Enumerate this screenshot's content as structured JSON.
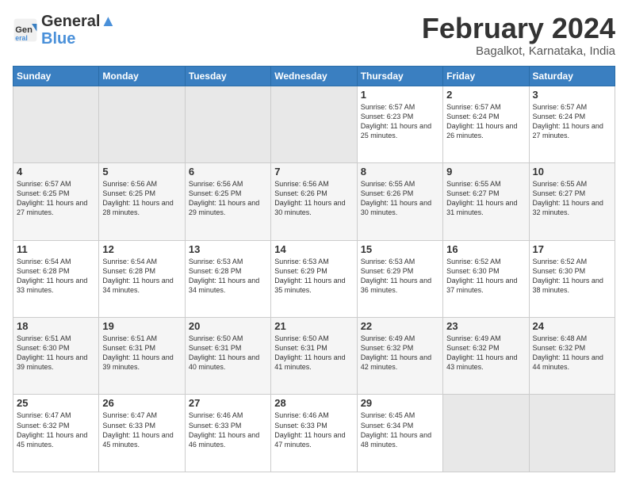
{
  "logo": {
    "line1": "General",
    "line2": "Blue"
  },
  "title": "February 2024",
  "subtitle": "Bagalkot, Karnataka, India",
  "headers": [
    "Sunday",
    "Monday",
    "Tuesday",
    "Wednesday",
    "Thursday",
    "Friday",
    "Saturday"
  ],
  "weeks": [
    [
      {
        "day": "",
        "info": ""
      },
      {
        "day": "",
        "info": ""
      },
      {
        "day": "",
        "info": ""
      },
      {
        "day": "",
        "info": ""
      },
      {
        "day": "1",
        "info": "Sunrise: 6:57 AM\nSunset: 6:23 PM\nDaylight: 11 hours\nand 25 minutes."
      },
      {
        "day": "2",
        "info": "Sunrise: 6:57 AM\nSunset: 6:24 PM\nDaylight: 11 hours\nand 26 minutes."
      },
      {
        "day": "3",
        "info": "Sunrise: 6:57 AM\nSunset: 6:24 PM\nDaylight: 11 hours\nand 27 minutes."
      }
    ],
    [
      {
        "day": "4",
        "info": "Sunrise: 6:57 AM\nSunset: 6:25 PM\nDaylight: 11 hours\nand 27 minutes."
      },
      {
        "day": "5",
        "info": "Sunrise: 6:56 AM\nSunset: 6:25 PM\nDaylight: 11 hours\nand 28 minutes."
      },
      {
        "day": "6",
        "info": "Sunrise: 6:56 AM\nSunset: 6:25 PM\nDaylight: 11 hours\nand 29 minutes."
      },
      {
        "day": "7",
        "info": "Sunrise: 6:56 AM\nSunset: 6:26 PM\nDaylight: 11 hours\nand 30 minutes."
      },
      {
        "day": "8",
        "info": "Sunrise: 6:55 AM\nSunset: 6:26 PM\nDaylight: 11 hours\nand 30 minutes."
      },
      {
        "day": "9",
        "info": "Sunrise: 6:55 AM\nSunset: 6:27 PM\nDaylight: 11 hours\nand 31 minutes."
      },
      {
        "day": "10",
        "info": "Sunrise: 6:55 AM\nSunset: 6:27 PM\nDaylight: 11 hours\nand 32 minutes."
      }
    ],
    [
      {
        "day": "11",
        "info": "Sunrise: 6:54 AM\nSunset: 6:28 PM\nDaylight: 11 hours\nand 33 minutes."
      },
      {
        "day": "12",
        "info": "Sunrise: 6:54 AM\nSunset: 6:28 PM\nDaylight: 11 hours\nand 34 minutes."
      },
      {
        "day": "13",
        "info": "Sunrise: 6:53 AM\nSunset: 6:28 PM\nDaylight: 11 hours\nand 34 minutes."
      },
      {
        "day": "14",
        "info": "Sunrise: 6:53 AM\nSunset: 6:29 PM\nDaylight: 11 hours\nand 35 minutes."
      },
      {
        "day": "15",
        "info": "Sunrise: 6:53 AM\nSunset: 6:29 PM\nDaylight: 11 hours\nand 36 minutes."
      },
      {
        "day": "16",
        "info": "Sunrise: 6:52 AM\nSunset: 6:30 PM\nDaylight: 11 hours\nand 37 minutes."
      },
      {
        "day": "17",
        "info": "Sunrise: 6:52 AM\nSunset: 6:30 PM\nDaylight: 11 hours\nand 38 minutes."
      }
    ],
    [
      {
        "day": "18",
        "info": "Sunrise: 6:51 AM\nSunset: 6:30 PM\nDaylight: 11 hours\nand 39 minutes."
      },
      {
        "day": "19",
        "info": "Sunrise: 6:51 AM\nSunset: 6:31 PM\nDaylight: 11 hours\nand 39 minutes."
      },
      {
        "day": "20",
        "info": "Sunrise: 6:50 AM\nSunset: 6:31 PM\nDaylight: 11 hours\nand 40 minutes."
      },
      {
        "day": "21",
        "info": "Sunrise: 6:50 AM\nSunset: 6:31 PM\nDaylight: 11 hours\nand 41 minutes."
      },
      {
        "day": "22",
        "info": "Sunrise: 6:49 AM\nSunset: 6:32 PM\nDaylight: 11 hours\nand 42 minutes."
      },
      {
        "day": "23",
        "info": "Sunrise: 6:49 AM\nSunset: 6:32 PM\nDaylight: 11 hours\nand 43 minutes."
      },
      {
        "day": "24",
        "info": "Sunrise: 6:48 AM\nSunset: 6:32 PM\nDaylight: 11 hours\nand 44 minutes."
      }
    ],
    [
      {
        "day": "25",
        "info": "Sunrise: 6:47 AM\nSunset: 6:32 PM\nDaylight: 11 hours\nand 45 minutes."
      },
      {
        "day": "26",
        "info": "Sunrise: 6:47 AM\nSunset: 6:33 PM\nDaylight: 11 hours\nand 45 minutes."
      },
      {
        "day": "27",
        "info": "Sunrise: 6:46 AM\nSunset: 6:33 PM\nDaylight: 11 hours\nand 46 minutes."
      },
      {
        "day": "28",
        "info": "Sunrise: 6:46 AM\nSunset: 6:33 PM\nDaylight: 11 hours\nand 47 minutes."
      },
      {
        "day": "29",
        "info": "Sunrise: 6:45 AM\nSunset: 6:34 PM\nDaylight: 11 hours\nand 48 minutes."
      },
      {
        "day": "",
        "info": ""
      },
      {
        "day": "",
        "info": ""
      }
    ]
  ]
}
